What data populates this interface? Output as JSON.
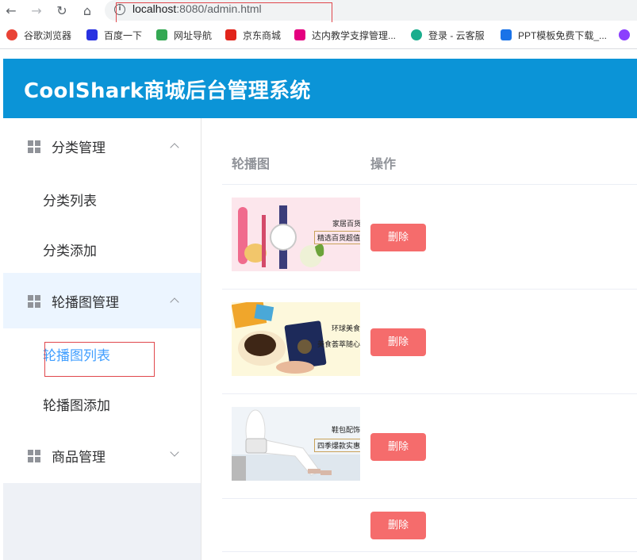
{
  "browser": {
    "url_host": "localhost",
    "url_rest": ":8080/admin.html",
    "bookmarks": [
      {
        "label": "谷歌浏览器",
        "color": "#e94235"
      },
      {
        "label": "百度一下",
        "color": "#2932e1"
      },
      {
        "label": "网址导航",
        "color": "#34a853"
      },
      {
        "label": "京东商城",
        "color": "#e1251b"
      },
      {
        "label": "达内教学支撑管理...",
        "color": "#e4007f"
      },
      {
        "label": "登录 - 云客服",
        "color": "#1aad8d"
      },
      {
        "label": "PPT模板免费下载_...",
        "color": "#1a73e8"
      }
    ]
  },
  "header": {
    "title": "CoolShark商城后台管理系统",
    "bg_color": "#0b94d7"
  },
  "sidebar": {
    "groups": [
      {
        "label": "分类管理",
        "expanded": true,
        "items": [
          "分类列表",
          "分类添加"
        ]
      },
      {
        "label": "轮播图管理",
        "expanded": true,
        "active": true,
        "items": [
          "轮播图列表",
          "轮播图添加"
        ],
        "active_item": "轮播图列表"
      },
      {
        "label": "商品管理",
        "expanded": false,
        "items": []
      }
    ]
  },
  "table": {
    "columns": [
      "轮播图",
      "操作"
    ],
    "rows": [
      {
        "banner": {
          "tag": "家居百货",
          "sub": "精选百货超值",
          "theme": "home"
        },
        "action": "删除"
      },
      {
        "banner": {
          "tag": "环球美食",
          "sub": "美食荟萃随心",
          "theme": "food"
        },
        "action": "删除"
      },
      {
        "banner": {
          "tag": "鞋包配饰",
          "sub": "四季爆款实惠",
          "theme": "fashion"
        },
        "action": "删除"
      },
      {
        "banner": null,
        "action": "删除"
      }
    ]
  },
  "colors": {
    "accent": "#409eff",
    "danger": "#f56c6c",
    "header": "#0b94d7"
  }
}
